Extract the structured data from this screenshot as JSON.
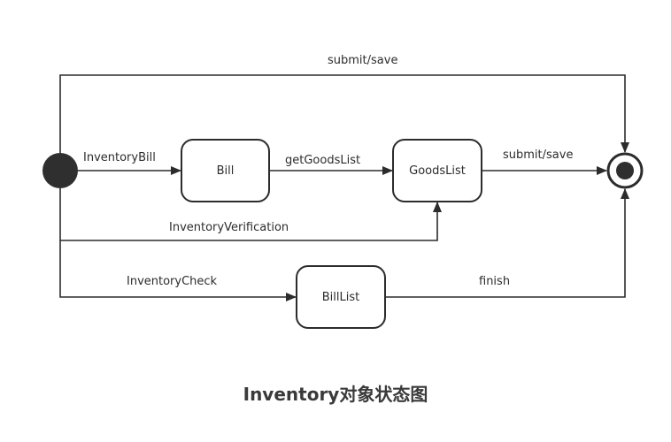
{
  "diagram": {
    "title": "Inventory对象状态图",
    "states": {
      "bill": "Bill",
      "goods_list": "GoodsList",
      "bill_list": "BillList"
    },
    "transitions": {
      "top_submit_save": "submit/save",
      "inventory_bill": "InventoryBill",
      "get_goods_list": "getGoodsList",
      "goods_submit_save": "submit/save",
      "inventory_verification": "InventoryVerification",
      "inventory_check": "InventoryCheck",
      "finish": "finish"
    },
    "colors": {
      "stroke": "#2c2c2c",
      "initial_fill": "#2f2f2f",
      "text": "#2c2c2c"
    }
  }
}
